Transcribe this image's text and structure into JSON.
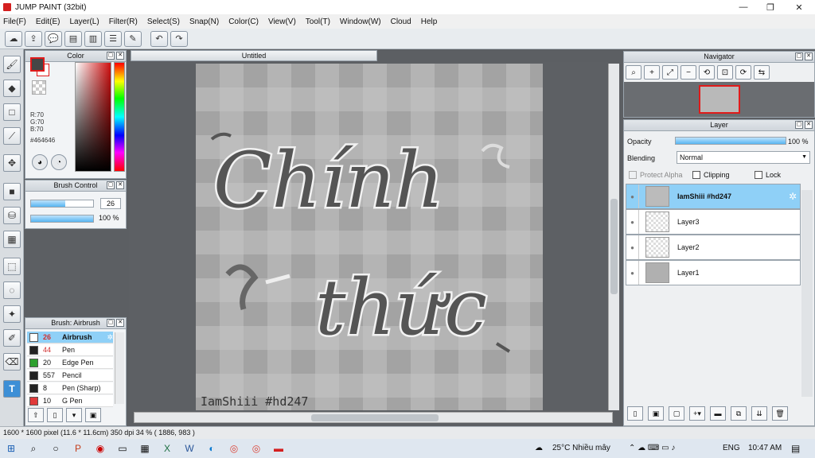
{
  "window": {
    "title": "JUMP PAINT (32bit)"
  },
  "menu": [
    "File(F)",
    "Edit(E)",
    "Layer(L)",
    "Filter(R)",
    "Select(S)",
    "Snap(N)",
    "Color(C)",
    "View(V)",
    "Tool(T)",
    "Window(W)",
    "Cloud",
    "Help"
  ],
  "color_panel": {
    "title": "Color",
    "r": "R:70",
    "g": "G:70",
    "b": "B:70",
    "hex": "#464646",
    "fg_color": "#464646"
  },
  "brush_control": {
    "title": "Brush Control",
    "size": "26",
    "opacity": "100 %",
    "size_fraction": 0.55,
    "opacity_fraction": 1.0
  },
  "brush_list": {
    "title": "Brush: Airbrush",
    "items": [
      {
        "size": "26",
        "name": "Airbrush",
        "color": "#ffffff",
        "selected": true
      },
      {
        "size": "44",
        "name": "Pen",
        "color": "#222222"
      },
      {
        "size": "20",
        "name": "Edge Pen",
        "color": "#2ea02e"
      },
      {
        "size": "557",
        "name": "Pencil",
        "color": "#222222"
      },
      {
        "size": "8",
        "name": "Pen (Sharp)",
        "color": "#222222"
      },
      {
        "size": "10",
        "name": "G Pen",
        "color": "#e03a3a"
      }
    ]
  },
  "document": {
    "tab": "Untitled",
    "line1": "Chính",
    "line2": "thức",
    "signature": "IamShiii #hd247"
  },
  "navigator": {
    "title": "Navigator"
  },
  "layer_panel": {
    "title": "Layer",
    "opacity_label": "Opacity",
    "opacity_value": "100 %",
    "blending_label": "Blending",
    "blending_value": "Normal",
    "protect_alpha": "Protect Alpha",
    "clipping": "Clipping",
    "lock": "Lock",
    "layers": [
      {
        "name": "IamShiii #hd247",
        "selected": true
      },
      {
        "name": "Layer3"
      },
      {
        "name": "Layer2"
      },
      {
        "name": "Layer1"
      }
    ]
  },
  "status": {
    "text": "1600 * 1600 pixel   (11.6 * 11.6cm)   350 dpi   34 %   ( 1886, 983 )"
  },
  "taskbar": {
    "weather": "25°C  Nhiều mây",
    "lang": "ENG",
    "time": "10:47 AM"
  }
}
